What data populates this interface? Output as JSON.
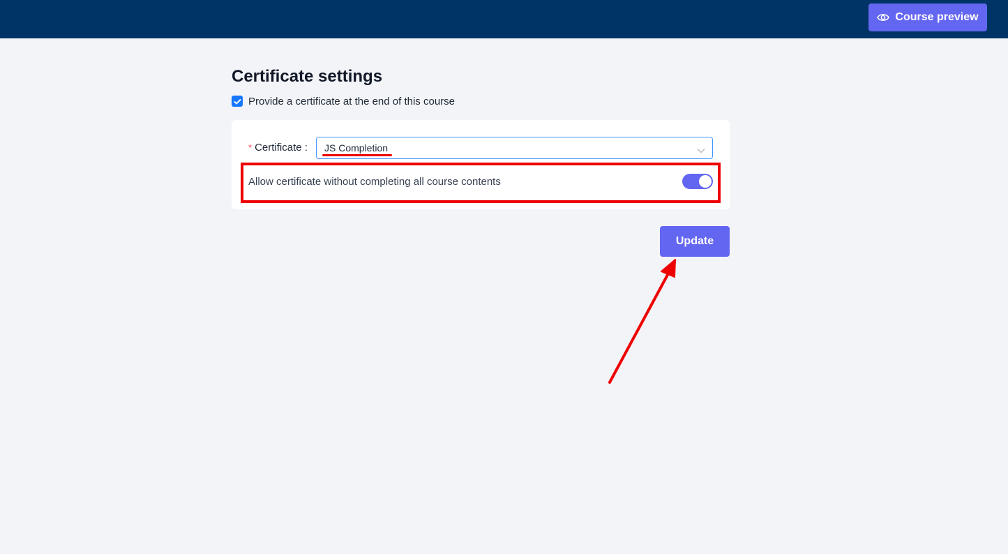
{
  "header": {
    "preview_button": {
      "label": "Course preview",
      "icon": "eye-icon"
    }
  },
  "page": {
    "title": "Certificate settings"
  },
  "provide_certificate": {
    "label": "Provide a certificate at the end of this course",
    "checked": true
  },
  "form": {
    "required_mark": "*",
    "certificate_label": "Certificate :",
    "certificate_value": "JS Completion",
    "allow_without_completion_label": "Allow certificate without completing all course contents",
    "allow_without_completion_on": true
  },
  "actions": {
    "update_label": "Update"
  },
  "colors": {
    "topbar": "#003366",
    "accent": "#6366f1",
    "annotation": "#ee0000"
  }
}
